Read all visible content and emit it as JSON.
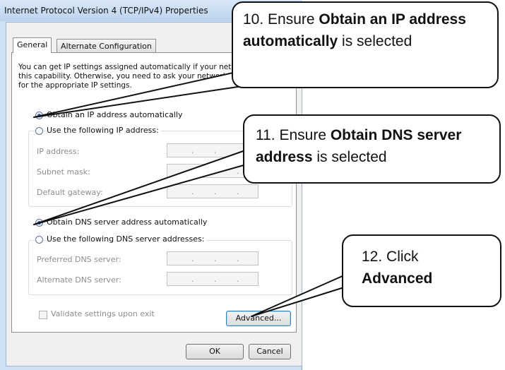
{
  "dialog": {
    "title": "Internet Protocol Version 4 (TCP/IPv4) Properties",
    "tabs": [
      "General",
      "Alternate Configuration"
    ],
    "intro_lines": [
      "You can get IP settings assigned automatically if your network supports",
      "this capability. Otherwise, you need to ask your network administrator",
      "for the appropriate IP settings."
    ],
    "ip_auto_label": "Obtain an IP address automatically",
    "ip_manual_label": "Use the following IP address:",
    "ip_address_label": "IP address:",
    "subnet_mask_label": "Subnet mask:",
    "default_gateway_label": "Default gateway:",
    "dns_auto_label": "Obtain DNS server address automatically",
    "dns_manual_label": "Use the following DNS server addresses:",
    "preferred_dns_label": "Preferred DNS server:",
    "alternate_dns_label": "Alternate DNS server:",
    "validate_label": "Validate settings upon exit",
    "advanced_button": "Advanced...",
    "ok_button": "OK",
    "cancel_button": "Cancel",
    "ip_dot": "."
  },
  "callouts": {
    "step10": {
      "prefix": "10. Ensure ",
      "bold": "Obtain an IP address automatically",
      "suffix": " is selected"
    },
    "step11": {
      "prefix": "11. Ensure ",
      "bold": "Obtain DNS server address",
      "suffix": " is selected"
    },
    "step12": {
      "prefix": "12. Click ",
      "bold": "Advanced",
      "suffix": ""
    }
  }
}
